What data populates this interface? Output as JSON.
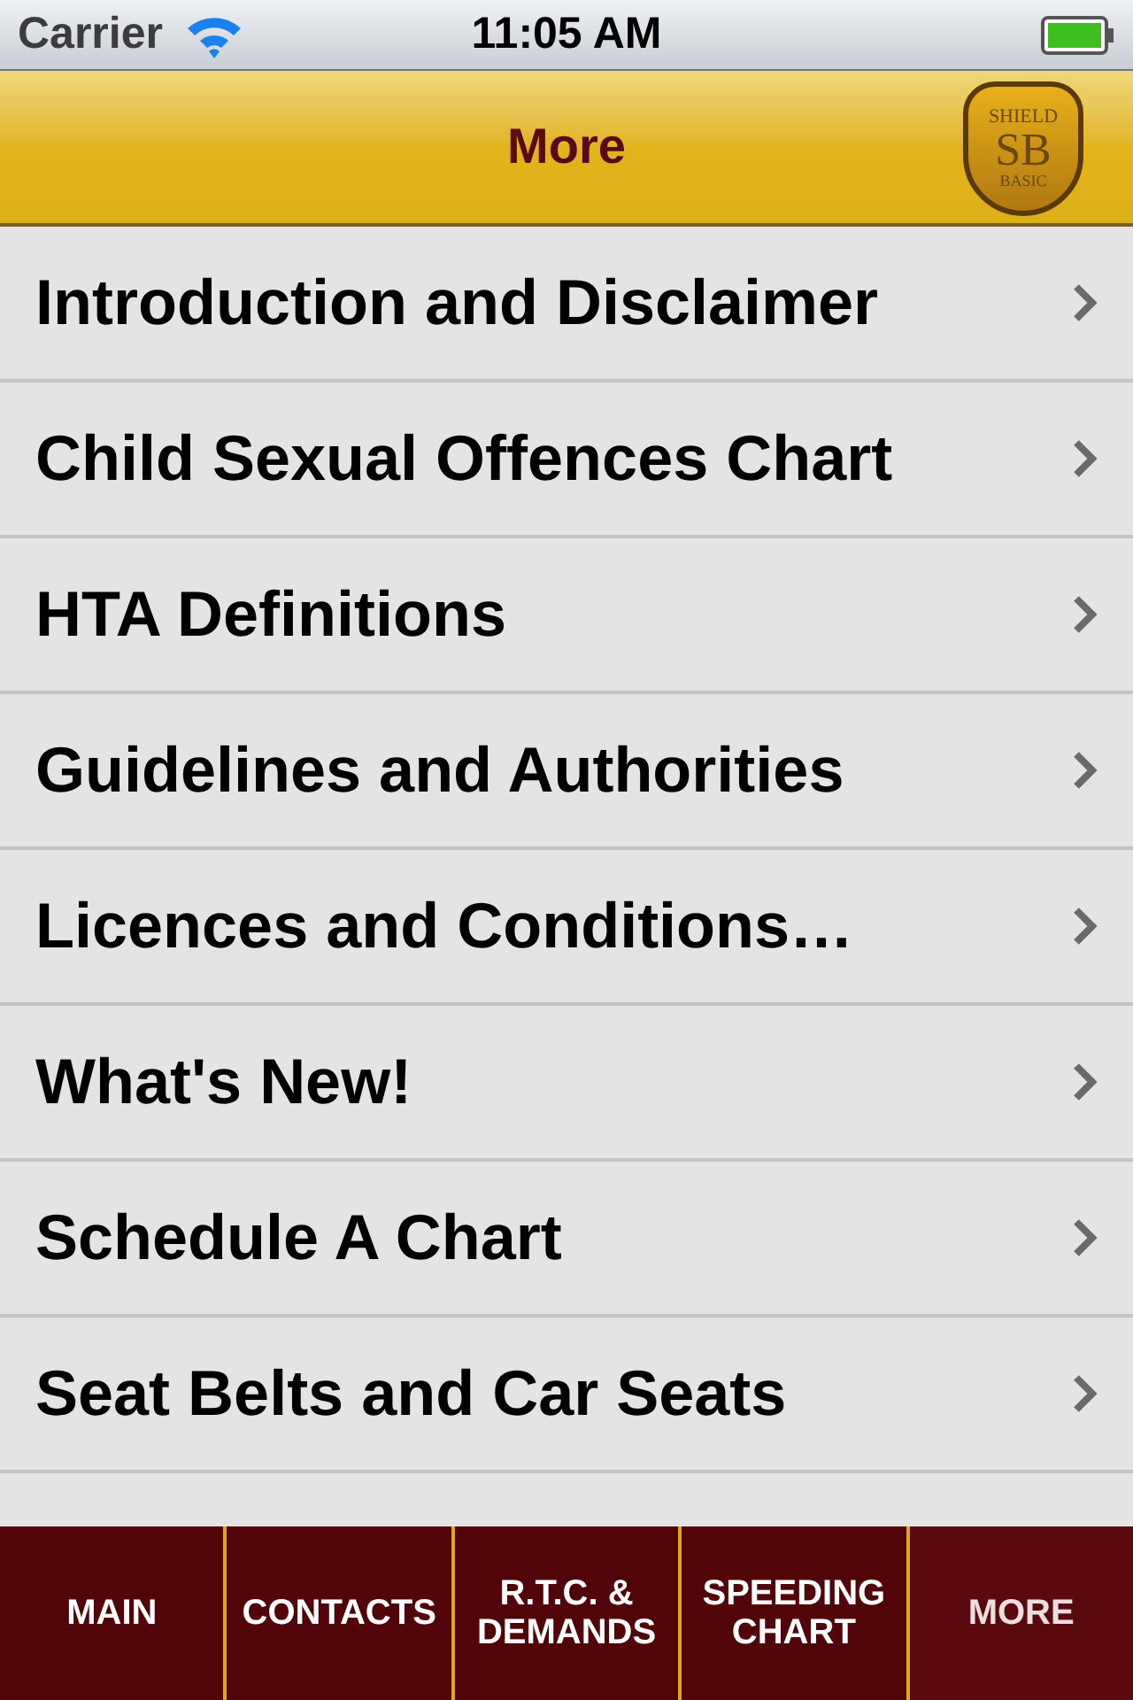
{
  "status_bar": {
    "carrier": "Carrier",
    "time": "11:05 AM"
  },
  "nav_bar": {
    "title": "More",
    "logo": {
      "top": "SHIELD",
      "middle": "SB",
      "bottom": "BASIC"
    }
  },
  "items": [
    {
      "label": "Introduction and Disclaimer"
    },
    {
      "label": "Child Sexual Offences Chart"
    },
    {
      "label": "HTA Definitions"
    },
    {
      "label": "Guidelines and Authorities"
    },
    {
      "label": "Licences and Conditions…"
    },
    {
      "label": "What's New!"
    },
    {
      "label": "Schedule A Chart"
    },
    {
      "label": "Seat Belts and Car Seats"
    }
  ],
  "tabs": [
    {
      "label": "MAIN",
      "selected": false
    },
    {
      "label": "CONTACTS",
      "selected": false
    },
    {
      "label": "R.T.C. & DEMANDS",
      "selected": false
    },
    {
      "label": "SPEEDING CHART",
      "selected": false
    },
    {
      "label": "MORE",
      "selected": true
    }
  ]
}
